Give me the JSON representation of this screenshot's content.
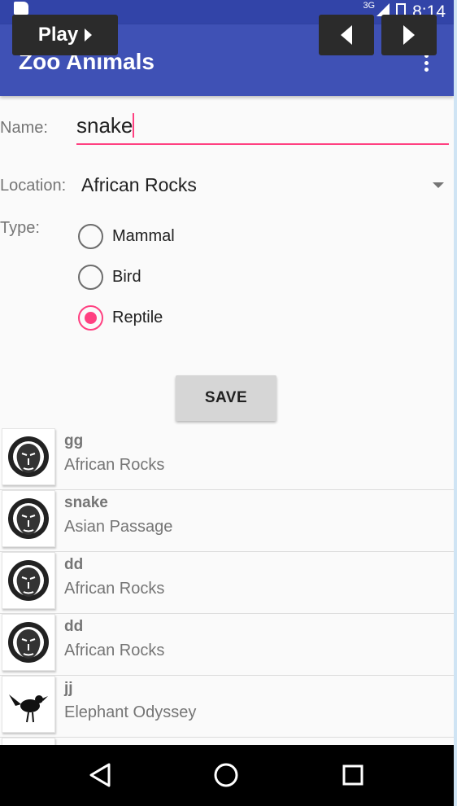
{
  "status_bar": {
    "network": "3G",
    "time": "8:14"
  },
  "app_bar": {
    "title": "Zoo Animals"
  },
  "overlay": {
    "play_label": "Play"
  },
  "form": {
    "name_label": "Name:",
    "name_value": "snake",
    "location_label": "Location:",
    "location_value": "African Rocks",
    "type_label": "Type:",
    "types": [
      {
        "label": "Mammal",
        "checked": false
      },
      {
        "label": "Bird",
        "checked": false
      },
      {
        "label": "Reptile",
        "checked": true
      }
    ],
    "save_label": "SAVE"
  },
  "list": {
    "items": [
      {
        "name": "gg",
        "location": "African Rocks",
        "icon": "lion-icon"
      },
      {
        "name": "snake",
        "location": "Asian Passage",
        "icon": "lion-icon"
      },
      {
        "name": "dd",
        "location": "African Rocks",
        "icon": "lion-icon"
      },
      {
        "name": "dd",
        "location": "African Rocks",
        "icon": "lion-icon"
      },
      {
        "name": "jj",
        "location": "Elephant Odyssey",
        "icon": "bird-icon"
      }
    ]
  },
  "colors": {
    "primary": "#3f51b5",
    "primary_dark": "#3244a8",
    "accent": "#ff4081"
  }
}
